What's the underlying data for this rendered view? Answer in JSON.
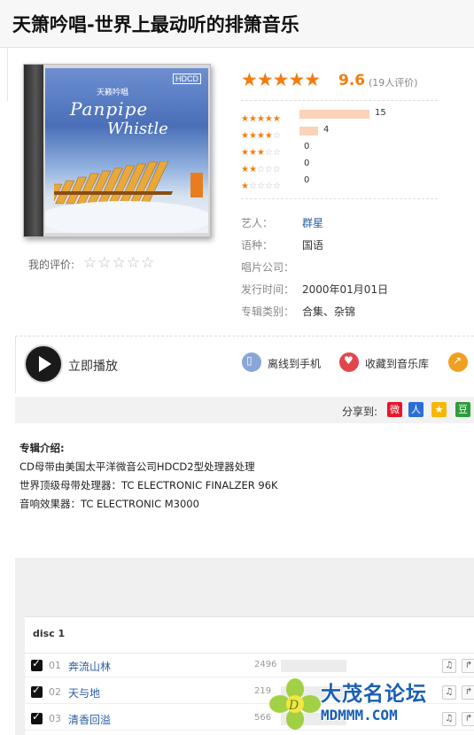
{
  "title": "天箫吟唱-世界上最动听的排箫音乐",
  "cover": {
    "badge_text": "HDCD",
    "album_cn": "天籁吟唱",
    "art_title_1": "Panpipe",
    "art_title_2": "Whistle"
  },
  "my_rating": {
    "label": "我的评价:",
    "stars": "☆☆☆☆☆"
  },
  "rating": {
    "stars": "★★★★★",
    "score": "9.6",
    "count_text": "(19人评价)",
    "distribution": [
      {
        "stars_full": "★★★★★",
        "stars_empty": "",
        "count": "15",
        "fraction": 0.789
      },
      {
        "stars_full": "★★★★",
        "stars_empty": "☆",
        "count": "4",
        "fraction": 0.21
      },
      {
        "stars_full": "★★★",
        "stars_empty": "☆☆",
        "count": "0",
        "fraction": 0
      },
      {
        "stars_full": "★★",
        "stars_empty": "☆☆☆",
        "count": "0",
        "fraction": 0
      },
      {
        "stars_full": "★",
        "stars_empty": "☆☆☆☆",
        "count": "0",
        "fraction": 0
      }
    ]
  },
  "info": {
    "artist_label": "艺人：",
    "artist": "群星",
    "lang_label": "语种：",
    "lang": "国语",
    "company_label": "唱片公司：",
    "company": "",
    "date_label": "发行时间：",
    "date": "2000年01月01日",
    "category_label": "专辑类别：",
    "category": "合集、杂锦"
  },
  "actions": {
    "play": "立即播放",
    "offline": "离线到手机",
    "collect": "收藏到音乐库"
  },
  "share": {
    "label": "分享到:",
    "targets": [
      "weibo-icon",
      "renren-icon",
      "qzone-icon",
      "douban-icon"
    ]
  },
  "intro": {
    "heading": "专辑介绍:",
    "lines": [
      "CD母带由美国太平洋微音公司HDCD2型处理器处理",
      "世界顶级母带处理器：TC ELECTRONIC FINALZER 96K",
      "音响效果器：TC ELECTRONIC M3000"
    ]
  },
  "tracklist": {
    "disc": "disc 1",
    "tracks": [
      {
        "no": "01",
        "name": "奔流山林",
        "count": "2496"
      },
      {
        "no": "02",
        "name": "天与地",
        "count": "219"
      },
      {
        "no": "03",
        "name": "清香回溢",
        "count": "566"
      }
    ]
  },
  "watermark": {
    "cn": "大茂名论坛",
    "en": "MDMMM.COM"
  },
  "colors": {
    "accent": "#f27d0f",
    "link": "#2a5da0",
    "watermark": "#1a5fb4"
  }
}
